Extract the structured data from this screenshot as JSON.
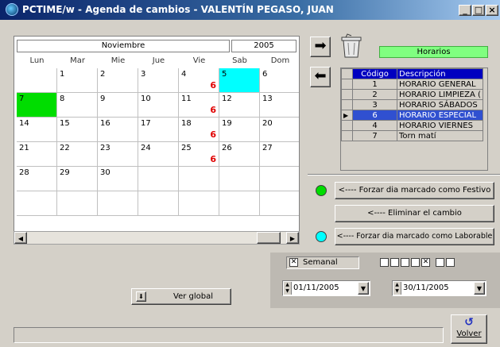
{
  "window": {
    "title": "PCTIME/w - Agenda de cambios - VALENTÍN PEGASO, JUAN"
  },
  "calendar": {
    "month": "Noviembre",
    "year": "2005",
    "weekdays": [
      "Lun",
      "Mar",
      "Mie",
      "Jue",
      "Vie",
      "Sab",
      "Dom"
    ],
    "weeks": [
      [
        {
          "d": ""
        },
        {
          "d": "1"
        },
        {
          "d": "2"
        },
        {
          "d": "3"
        },
        {
          "d": "4",
          "m": "6"
        },
        {
          "d": "5",
          "bg": "#00ffff"
        },
        {
          "d": "6"
        }
      ],
      [
        {
          "d": "7",
          "bg": "#00dd00"
        },
        {
          "d": "8"
        },
        {
          "d": "9"
        },
        {
          "d": "10"
        },
        {
          "d": "11",
          "m": "6"
        },
        {
          "d": "12"
        },
        {
          "d": "13"
        }
      ],
      [
        {
          "d": "14"
        },
        {
          "d": "15"
        },
        {
          "d": "16"
        },
        {
          "d": "17"
        },
        {
          "d": "18",
          "m": "6"
        },
        {
          "d": "19"
        },
        {
          "d": "20"
        }
      ],
      [
        {
          "d": "21"
        },
        {
          "d": "22"
        },
        {
          "d": "23"
        },
        {
          "d": "24"
        },
        {
          "d": "25",
          "m": "6"
        },
        {
          "d": "26"
        },
        {
          "d": "27"
        }
      ],
      [
        {
          "d": "28"
        },
        {
          "d": "29"
        },
        {
          "d": "30"
        },
        {
          "d": ""
        },
        {
          "d": ""
        },
        {
          "d": ""
        },
        {
          "d": ""
        }
      ],
      [
        {
          "d": ""
        },
        {
          "d": ""
        },
        {
          "d": ""
        },
        {
          "d": ""
        },
        {
          "d": ""
        },
        {
          "d": ""
        },
        {
          "d": ""
        }
      ]
    ]
  },
  "horarios": {
    "label": "Horarios",
    "columns": {
      "code": "Código",
      "desc": "Descripción"
    },
    "rows": [
      {
        "code": "1",
        "desc": "HORARIO  GENERAL"
      },
      {
        "code": "2",
        "desc": "HORARIO LIMPIEZA ("
      },
      {
        "code": "3",
        "desc": "HORARIO SÁBADOS"
      },
      {
        "code": "6",
        "desc": "HORARIO  ESPECIAL",
        "selected": true
      },
      {
        "code": "4",
        "desc": "HORARIO  VIERNES"
      },
      {
        "code": "7",
        "desc": "Torn matí"
      }
    ]
  },
  "actions": {
    "festivo_label": "<---- Forzar dia marcado como Festivo",
    "eliminar_label": "<---- Eliminar el cambio",
    "laborable_label": "<---- Forzar dia marcado como Laborable",
    "festivo_color": "#00dd00",
    "laborable_color": "#00ffff"
  },
  "options": {
    "semanal_label": "Semanal",
    "semanal_checked": true,
    "day_checks": [
      false,
      false,
      false,
      false,
      true,
      false,
      false
    ],
    "date_from": "01/11/2005",
    "date_to": "30/11/2005"
  },
  "buttons": {
    "ver_global": "Ver global",
    "volver": "Volver"
  },
  "status": {
    "text": ""
  }
}
